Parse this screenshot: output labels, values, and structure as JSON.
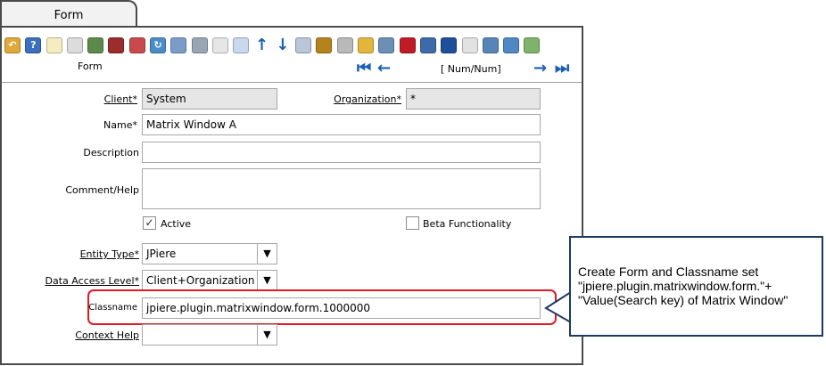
{
  "tab": {
    "title": "Form"
  },
  "toolbar": {
    "icons": [
      {
        "name": "undo-icon",
        "color": "#e0a83a",
        "glyph": "↶"
      },
      {
        "name": "help-icon",
        "color": "#3b6fbf",
        "glyph": "?"
      },
      {
        "name": "new-record-icon",
        "color": "#f5ecc0",
        "glyph": ""
      },
      {
        "name": "copy-record-icon",
        "color": "#dcdcdc",
        "glyph": ""
      },
      {
        "name": "delete-icon",
        "color": "#5d8a4a",
        "glyph": ""
      },
      {
        "name": "save-icon",
        "color": "#9b2d2d",
        "glyph": ""
      },
      {
        "name": "save-create-icon",
        "color": "#c94a4a",
        "glyph": ""
      },
      {
        "name": "refresh-icon",
        "color": "#4a8cc7",
        "glyph": "↻"
      },
      {
        "name": "find-icon",
        "color": "#7a9cc9",
        "glyph": ""
      },
      {
        "name": "attachment-icon",
        "color": "#9aa5b4",
        "glyph": ""
      },
      {
        "name": "chat-icon",
        "color": "#e6e6e6",
        "glyph": ""
      },
      {
        "name": "grid-toggle-icon",
        "color": "#c8d9ef",
        "glyph": ""
      },
      {
        "name": "parent-record-icon",
        "color": "#ffffff",
        "glyph": "↑"
      },
      {
        "name": "detail-record-icon",
        "color": "#ffffff",
        "glyph": "↓"
      },
      {
        "name": "history-icon",
        "color": "#b8c6d8",
        "glyph": ""
      },
      {
        "name": "archive-icon",
        "color": "#b5821c",
        "glyph": ""
      },
      {
        "name": "print-icon",
        "color": "#b9b9b9",
        "glyph": ""
      },
      {
        "name": "lock-icon",
        "color": "#e2b63c",
        "glyph": ""
      },
      {
        "name": "zoom-across-icon",
        "color": "#6b8fb5",
        "glyph": ""
      },
      {
        "name": "workflow-icon",
        "color": "#c01c28",
        "glyph": ""
      },
      {
        "name": "report-icon",
        "color": "#3d6aa8",
        "glyph": ""
      },
      {
        "name": "product-info-icon",
        "color": "#1f4f9a",
        "glyph": ""
      },
      {
        "name": "customize-icon",
        "color": "#e2e2e2",
        "glyph": ""
      },
      {
        "name": "settings-icon",
        "color": "#5785b8",
        "glyph": ""
      },
      {
        "name": "export-icon",
        "color": "#4f89c3",
        "glyph": ""
      },
      {
        "name": "import-icon",
        "color": "#7fb26a",
        "glyph": ""
      }
    ],
    "label": "Form",
    "record_indicator": "[ Num/Num]",
    "nav_first": "⏮",
    "nav_prev": "←",
    "nav_next": "→",
    "nav_last": "⏭"
  },
  "form": {
    "client": {
      "label": "Client",
      "required": "*",
      "value": "System"
    },
    "organization": {
      "label": "Organization",
      "required": "*",
      "value": "*"
    },
    "name": {
      "label": "Name",
      "required": "*",
      "value": "Matrix Window A"
    },
    "description": {
      "label": "Description",
      "value": ""
    },
    "comment_help": {
      "label": "Comment/Help",
      "value": ""
    },
    "active": {
      "label": "Active",
      "checked": "✓"
    },
    "beta": {
      "label": "Beta Functionality",
      "checked": ""
    },
    "entity_type": {
      "label": "Entity Type",
      "required": "*",
      "value": "JPiere"
    },
    "data_access_level": {
      "label": "Data Access Level",
      "required": "*",
      "value": "Client+Organization"
    },
    "classname": {
      "label": "Classname",
      "value": "jpiere.plugin.matrixwindow.form.1000000"
    },
    "context_help": {
      "label": "Context Help",
      "value": ""
    },
    "dropdown_arrow": "▼"
  },
  "callout": {
    "text": "Create Form and Classname set\n\"jpiere.plugin.matrixwindow.form.\"+\n\"Value(Search key) of Matrix Window\"",
    "border_color": "#1f3864"
  },
  "highlight_color": "#e01b24"
}
